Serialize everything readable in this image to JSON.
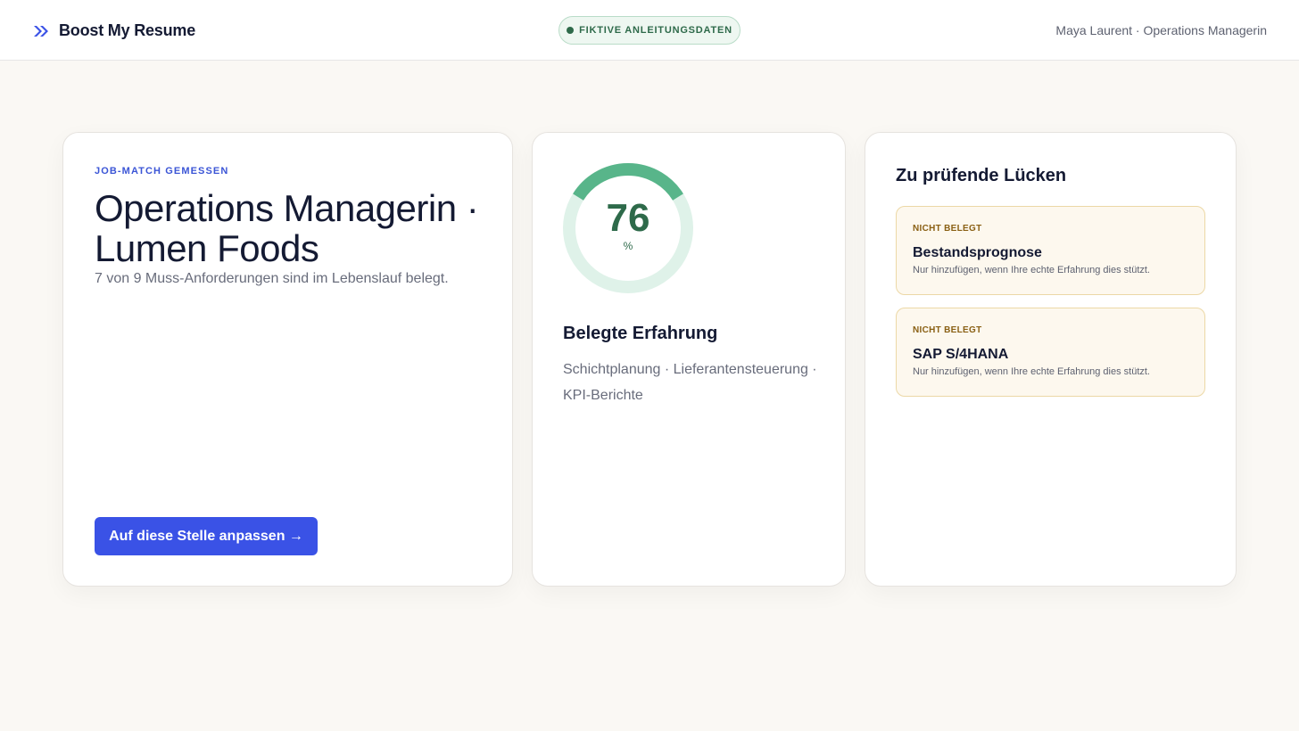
{
  "header": {
    "brand_name": "Boost My Resume",
    "badge_label": "FIKTIVE ANLEITUNGSDATEN",
    "user_info": "Maya Laurent · Operations Managerin"
  },
  "job_card": {
    "eyebrow": "JOB-MATCH GEMESSEN",
    "title": "Operations Managerin · Lumen Foods",
    "summary": "7 von 9 Muss-Anforderungen sind im Lebenslauf belegt.",
    "cta_label": "Auf diese Stelle anpassen →"
  },
  "score_card": {
    "score": "76",
    "score_fraction": 0.76,
    "unit": "%",
    "section_title": "Belegte Erfahrung",
    "skills_text": "Schichtplanung · Lieferantensteuerung · KPI-Berichte"
  },
  "gaps_card": {
    "title": "Zu prüfende Lücken",
    "items": [
      {
        "status": "NICHT BELEGT",
        "name": "Bestandsprognose",
        "note": "Nur hinzufügen, wenn Ihre echte Erfahrung dies stützt."
      },
      {
        "status": "NICHT BELEGT",
        "name": "SAP S/4HANA",
        "note": "Nur hinzufügen, wenn Ihre echte Erfahrung dies stützt."
      }
    ]
  },
  "colors": {
    "accent": "#3a52e6",
    "success": "#2e6a4a",
    "gauge_track": "#dff2e9",
    "gauge_fill": "#58b58a",
    "warning_bg": "#fdf8ee",
    "warning_text": "#8a6014"
  },
  "icons": {
    "brand": "double-chevron-right-icon",
    "badge": "status-dot-icon"
  }
}
